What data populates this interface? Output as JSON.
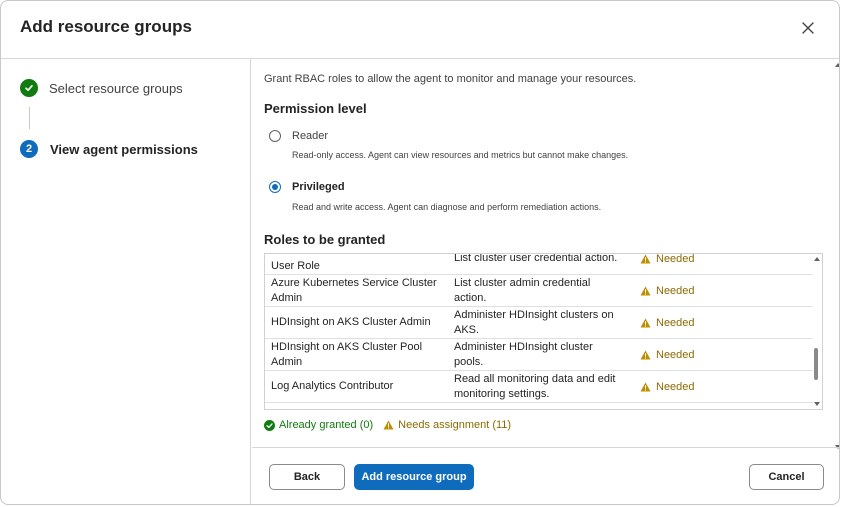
{
  "dialog": {
    "title": "Add resource groups",
    "close_icon": "close-icon"
  },
  "stepper": {
    "steps": [
      {
        "number": "",
        "label": "Select resource groups",
        "state": "completed",
        "icon": "checkmark-icon"
      },
      {
        "number": "2",
        "label": "View agent permissions",
        "state": "current"
      }
    ]
  },
  "main": {
    "intro": "Grant RBAC roles to allow the agent to monitor and manage your resources.",
    "permission_title": "Permission level",
    "options": [
      {
        "label": "Reader",
        "description": "Read-only access. Agent can view resources and metrics but cannot make changes.",
        "selected": false
      },
      {
        "label": "Privileged",
        "description": "Read and write access. Agent can diagnose and perform remediation actions.",
        "selected": true
      }
    ],
    "roles_title": "Roles to be granted",
    "roles": [
      {
        "name": "Azure Kubernetes Service Cluster User Role",
        "description": "List cluster user credential action.",
        "status": "Needed"
      },
      {
        "name": "Azure Kubernetes Service Cluster Admin",
        "description": "List cluster admin credential action.",
        "status": "Needed"
      },
      {
        "name": "HDInsight on AKS Cluster Admin",
        "description": "Administer HDInsight clusters on AKS.",
        "status": "Needed"
      },
      {
        "name": "HDInsight on AKS Cluster Pool Admin",
        "description": "Administer HDInsight cluster pools.",
        "status": "Needed"
      },
      {
        "name": "Log Analytics Contributor",
        "description": "Read all monitoring data and edit monitoring settings.",
        "status": "Needed"
      }
    ],
    "legend": {
      "granted": "Already granted (0)",
      "needs": "Needs assignment (11)"
    }
  },
  "footer": {
    "back_label": "Back",
    "add_label": "Add resource group",
    "cancel_label": "Cancel"
  },
  "colors": {
    "accent": "#0f6cbd",
    "success": "#107c10",
    "warning": "#8a6b00",
    "warning_icon": "#bc8f00"
  }
}
